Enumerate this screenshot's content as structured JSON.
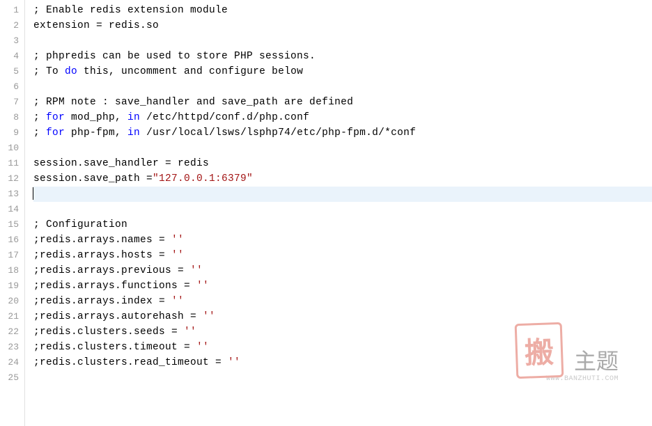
{
  "lines": [
    {
      "num": 1,
      "seg": [
        {
          "cls": "txt",
          "t": "; Enable redis extension module"
        }
      ]
    },
    {
      "num": 2,
      "seg": [
        {
          "cls": "txt",
          "t": "extension = redis.so"
        }
      ]
    },
    {
      "num": 3,
      "seg": [
        {
          "cls": "txt",
          "t": ""
        }
      ]
    },
    {
      "num": 4,
      "seg": [
        {
          "cls": "txt",
          "t": "; phpredis can be used to store PHP sessions."
        }
      ]
    },
    {
      "num": 5,
      "seg": [
        {
          "cls": "txt",
          "t": "; To "
        },
        {
          "cls": "kw",
          "t": "do"
        },
        {
          "cls": "txt",
          "t": " this, uncomment and configure below"
        }
      ]
    },
    {
      "num": 6,
      "seg": [
        {
          "cls": "txt",
          "t": ""
        }
      ]
    },
    {
      "num": 7,
      "seg": [
        {
          "cls": "txt",
          "t": "; RPM note : save_handler and save_path are defined"
        }
      ]
    },
    {
      "num": 8,
      "seg": [
        {
          "cls": "txt",
          "t": "; "
        },
        {
          "cls": "kw",
          "t": "for"
        },
        {
          "cls": "txt",
          "t": " mod_php, "
        },
        {
          "cls": "kw",
          "t": "in"
        },
        {
          "cls": "txt",
          "t": " /etc/httpd/conf.d/php.conf"
        }
      ]
    },
    {
      "num": 9,
      "seg": [
        {
          "cls": "txt",
          "t": "; "
        },
        {
          "cls": "kw",
          "t": "for"
        },
        {
          "cls": "txt",
          "t": " php-fpm, "
        },
        {
          "cls": "kw",
          "t": "in"
        },
        {
          "cls": "txt",
          "t": " /usr/local/lsws/lsphp74/etc/php-fpm.d/*conf"
        }
      ]
    },
    {
      "num": 10,
      "seg": [
        {
          "cls": "txt",
          "t": ""
        }
      ]
    },
    {
      "num": 11,
      "seg": [
        {
          "cls": "txt",
          "t": "session.save_handler = redis"
        }
      ]
    },
    {
      "num": 12,
      "seg": [
        {
          "cls": "txt",
          "t": "session.save_path ="
        },
        {
          "cls": "str",
          "t": "\"127.0.0.1:6379\""
        }
      ]
    },
    {
      "num": 13,
      "seg": [
        {
          "cls": "txt",
          "t": ""
        }
      ],
      "active": true,
      "cursor": true
    },
    {
      "num": 14,
      "seg": [
        {
          "cls": "txt",
          "t": ""
        }
      ]
    },
    {
      "num": 15,
      "seg": [
        {
          "cls": "txt",
          "t": "; Configuration"
        }
      ]
    },
    {
      "num": 16,
      "seg": [
        {
          "cls": "txt",
          "t": ";redis.arrays.names = "
        },
        {
          "cls": "str",
          "t": "''"
        }
      ]
    },
    {
      "num": 17,
      "seg": [
        {
          "cls": "txt",
          "t": ";redis.arrays.hosts = "
        },
        {
          "cls": "str",
          "t": "''"
        }
      ]
    },
    {
      "num": 18,
      "seg": [
        {
          "cls": "txt",
          "t": ";redis.arrays.previous = "
        },
        {
          "cls": "str",
          "t": "''"
        }
      ]
    },
    {
      "num": 19,
      "seg": [
        {
          "cls": "txt",
          "t": ";redis.arrays.functions = "
        },
        {
          "cls": "str",
          "t": "''"
        }
      ]
    },
    {
      "num": 20,
      "seg": [
        {
          "cls": "txt",
          "t": ";redis.arrays.index = "
        },
        {
          "cls": "str",
          "t": "''"
        }
      ]
    },
    {
      "num": 21,
      "seg": [
        {
          "cls": "txt",
          "t": ";redis.arrays.autorehash = "
        },
        {
          "cls": "str",
          "t": "''"
        }
      ]
    },
    {
      "num": 22,
      "seg": [
        {
          "cls": "txt",
          "t": ";redis.clusters.seeds = "
        },
        {
          "cls": "str",
          "t": "''"
        }
      ]
    },
    {
      "num": 23,
      "seg": [
        {
          "cls": "txt",
          "t": ";redis.clusters.timeout = "
        },
        {
          "cls": "str",
          "t": "''"
        }
      ]
    },
    {
      "num": 24,
      "seg": [
        {
          "cls": "txt",
          "t": ";redis.clusters.read_timeout = "
        },
        {
          "cls": "str",
          "t": "''"
        }
      ]
    },
    {
      "num": 25,
      "seg": [
        {
          "cls": "txt",
          "t": ""
        }
      ]
    }
  ],
  "watermark": {
    "stamp": "搬",
    "text": "主题",
    "url": "WWW.BANZHUTI.COM"
  }
}
